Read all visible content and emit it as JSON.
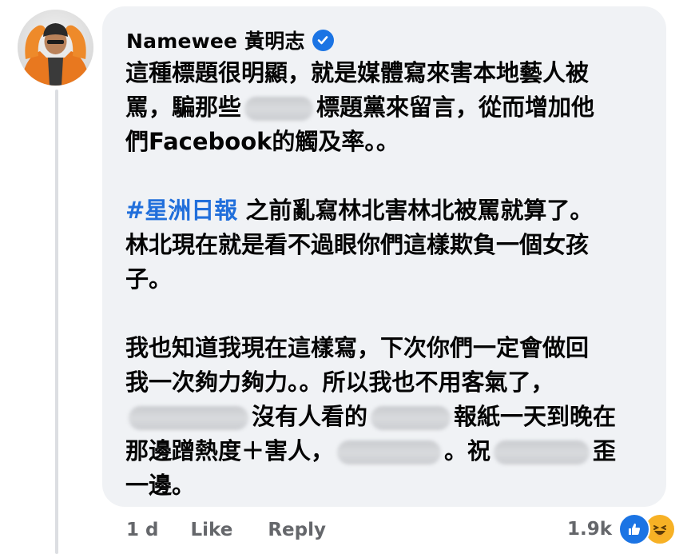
{
  "comment": {
    "author": "Namewee 黃明志",
    "lines": [
      {
        "segments": [
          {
            "text": "這種標題很明顯，就是媒體寫來害本地藝人被"
          }
        ]
      },
      {
        "segments": [
          {
            "text": "罵，騙那些"
          },
          {
            "blur": 86
          },
          {
            "text": "標題黨來留言，從而增加他"
          }
        ]
      },
      {
        "segments": [
          {
            "text": "們Facebook的觸及率。。"
          }
        ]
      },
      {
        "gap": true
      },
      {
        "segments": [
          {
            "text": "#星洲日報",
            "hashtag": true
          },
          {
            "text": " 之前亂寫林北害林北被罵就算了。"
          }
        ]
      },
      {
        "segments": [
          {
            "text": "林北現在就是看不過眼你們這樣欺負一個女孩"
          }
        ]
      },
      {
        "segments": [
          {
            "text": "子。"
          }
        ]
      },
      {
        "gap": true
      },
      {
        "segments": [
          {
            "text": "我也知道我現在這樣寫，下次你們一定會做回"
          }
        ]
      },
      {
        "segments": [
          {
            "text": "我一次夠力夠力。。所以我也不用客氣了，"
          }
        ]
      },
      {
        "segments": [
          {
            "blur": 150
          },
          {
            "text": "沒有人看的"
          },
          {
            "blur": 100
          },
          {
            "text": "報紙一天到晚在"
          }
        ]
      },
      {
        "segments": [
          {
            "text": "那邊蹭熱度＋害人，"
          },
          {
            "blur": 130
          },
          {
            "text": "。祝"
          },
          {
            "blur": 120
          },
          {
            "text": "歪"
          }
        ]
      },
      {
        "segments": [
          {
            "text": "一邊。"
          }
        ]
      }
    ]
  },
  "footer": {
    "time": "1 d",
    "like_label": "Like",
    "reply_label": "Reply"
  },
  "reactions": {
    "count": "1.9k",
    "icons": [
      "like-icon",
      "haha-icon"
    ]
  },
  "colors": {
    "bubble": "#f0f2f5",
    "hashtag": "#216fdb",
    "meta_text": "#65676b",
    "verified": "#1b74e4",
    "like": "#1b74e4",
    "haha": "#f7b125"
  }
}
